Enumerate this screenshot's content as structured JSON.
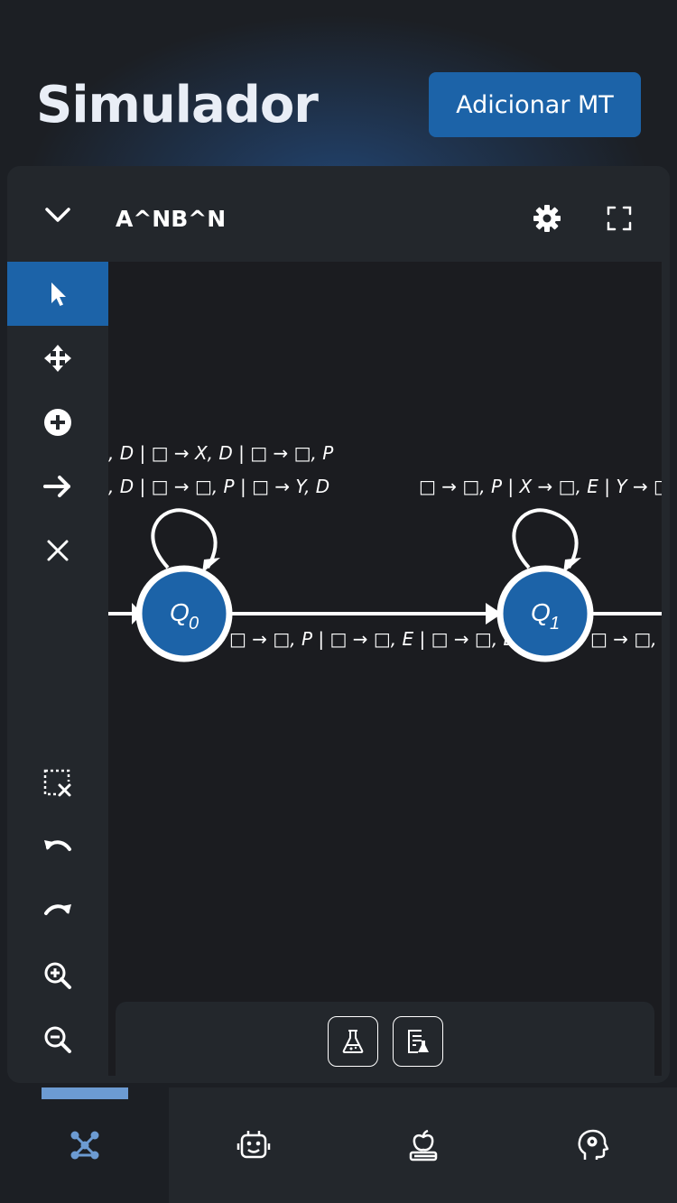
{
  "header": {
    "title": "Simulador",
    "add_button_label": "Adicionar MT"
  },
  "panel": {
    "machine_name": "A^NB^N"
  },
  "colors": {
    "accent": "#1c63a8",
    "background": "#1c1f24",
    "panel": "#23272c",
    "canvas": "#1b1c20",
    "indicator": "#6c9bd2"
  },
  "toolbar": {
    "tools": [
      "pointer-icon",
      "move-icon",
      "add-state-icon",
      "add-transition-icon",
      "delete-icon"
    ],
    "bottom_tools": [
      "clear-selection-icon",
      "undo-icon",
      "redo-icon",
      "zoom-in-icon",
      "zoom-out-icon"
    ],
    "active_tool": "pointer-icon"
  },
  "diagram": {
    "states": [
      {
        "id": "q0",
        "letter": "Q",
        "subscript": "0"
      },
      {
        "id": "q1",
        "letter": "Q",
        "subscript": "1"
      }
    ],
    "labels": {
      "q0_loop_line1": ", D | □ → X, D | □ → □, P",
      "q0_loop_line2": ", D | □ → □, P | □ → Y, D",
      "q1_loop_line1": "□ → □, P | X → □, E | Y → □",
      "q0_q1_edge": "□ → □, P | □ → □, E | □ → □, E",
      "q1_out_edge": "□ → □, "
    }
  },
  "bottom_buttons": [
    "flask-icon",
    "test-list-icon"
  ],
  "nav": {
    "items": [
      "graph-icon",
      "robot-icon",
      "apple-book-icon",
      "head-gear-icon"
    ],
    "active": "graph-icon"
  }
}
